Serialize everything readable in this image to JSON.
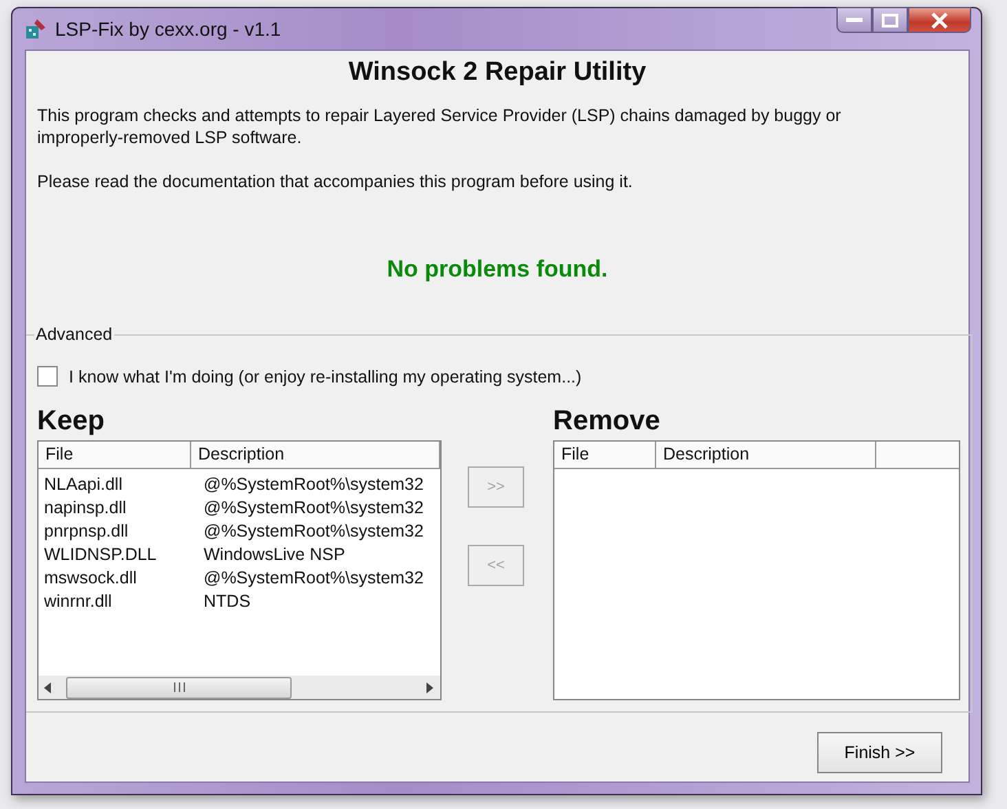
{
  "window": {
    "title": "LSP-Fix by cexx.org - v1.1"
  },
  "heading": "Winsock 2 Repair Utility",
  "intro": "This program checks and attempts to repair Layered Service Provider (LSP) chains damaged by buggy or improperly-removed LSP software.",
  "note": "Please read the documentation that accompanies this program before using it.",
  "status": "No problems found.",
  "advanced": {
    "legend": "Advanced",
    "checkbox": {
      "label": "I know what I'm doing (or enjoy re-installing my operating system...)",
      "checked": false
    }
  },
  "keep": {
    "title": "Keep",
    "columns": [
      "File",
      "Description"
    ],
    "rows": [
      {
        "file": "NLAapi.dll",
        "description": "@%SystemRoot%\\system32"
      },
      {
        "file": "napinsp.dll",
        "description": "@%SystemRoot%\\system32"
      },
      {
        "file": "pnrpnsp.dll",
        "description": "@%SystemRoot%\\system32"
      },
      {
        "file": "WLIDNSP.DLL",
        "description": "WindowsLive NSP"
      },
      {
        "file": "mswsock.dll",
        "description": "@%SystemRoot%\\system32"
      },
      {
        "file": "winrnr.dll",
        "description": "NTDS"
      }
    ]
  },
  "transfer_buttons": [
    {
      "label": ">>",
      "disabled": true
    },
    {
      "label": "<<",
      "disabled": true
    }
  ],
  "remove": {
    "title": "Remove",
    "columns": [
      "File",
      "Description"
    ]
  },
  "buttons": [
    {
      "label": "Finish >>"
    }
  ]
}
